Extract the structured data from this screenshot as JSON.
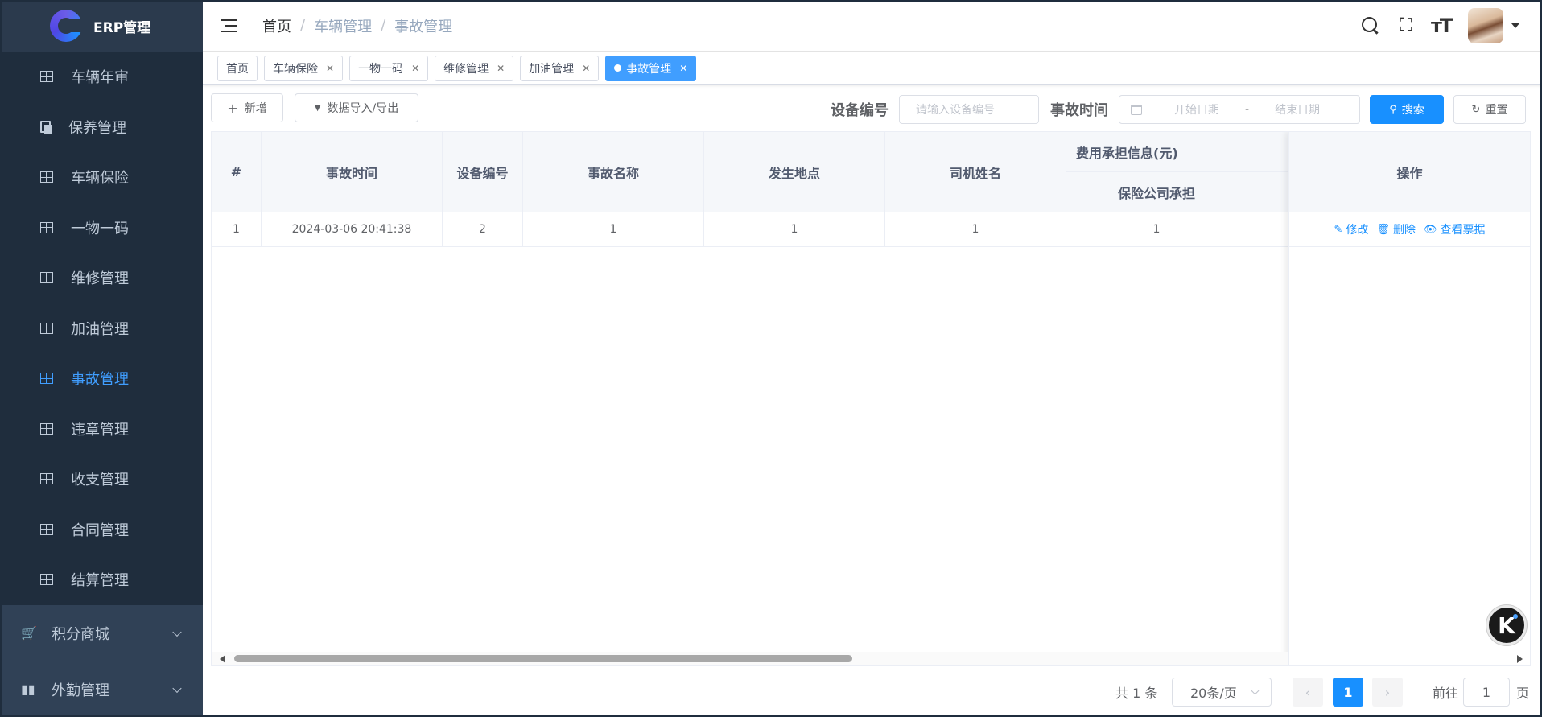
{
  "app": {
    "logo_text": "ERP管理"
  },
  "sidebar": {
    "items": [
      {
        "label": "车辆年审",
        "icon": "table-icon",
        "active": false
      },
      {
        "label": "保养管理",
        "icon": "copy-icon",
        "active": false
      },
      {
        "label": "车辆保险",
        "icon": "table-icon",
        "active": false
      },
      {
        "label": "一物一码",
        "icon": "table-icon",
        "active": false
      },
      {
        "label": "维修管理",
        "icon": "table-icon",
        "active": false
      },
      {
        "label": "加油管理",
        "icon": "table-icon",
        "active": false
      },
      {
        "label": "事故管理",
        "icon": "table-icon",
        "active": true
      },
      {
        "label": "违章管理",
        "icon": "table-icon",
        "active": false
      },
      {
        "label": "收支管理",
        "icon": "table-icon",
        "active": false
      },
      {
        "label": "合同管理",
        "icon": "table-icon",
        "active": false
      },
      {
        "label": "结算管理",
        "icon": "table-icon",
        "active": false
      }
    ],
    "groups": [
      {
        "label": "积分商城",
        "icon": "cart-icon"
      },
      {
        "label": "外勤管理",
        "icon": "bar-chart-icon"
      }
    ]
  },
  "header": {
    "breadcrumb": [
      "首页",
      "车辆管理",
      "事故管理"
    ],
    "separator": "/"
  },
  "tags": [
    {
      "label": "首页",
      "closable": false,
      "active": false
    },
    {
      "label": "车辆保险",
      "closable": true,
      "active": false
    },
    {
      "label": "一物一码",
      "closable": true,
      "active": false
    },
    {
      "label": "维修管理",
      "closable": true,
      "active": false
    },
    {
      "label": "加油管理",
      "closable": true,
      "active": false
    },
    {
      "label": "事故管理",
      "closable": true,
      "active": true
    }
  ],
  "toolbar": {
    "add_label": "新增",
    "import_export_label": "数据导入/导出",
    "device_no_label": "设备编号",
    "device_no_placeholder": "请输入设备编号",
    "accident_time_label": "事故时间",
    "start_date_placeholder": "开始日期",
    "date_separator": "-",
    "end_date_placeholder": "结束日期",
    "search_label": "搜索",
    "reset_label": "重置"
  },
  "table": {
    "headers": {
      "index": "#",
      "accident_time": "事故时间",
      "device_no": "设备编号",
      "accident_name": "事故名称",
      "location": "发生地点",
      "driver_name": "司机姓名",
      "cost_group": "费用承担信息(元)",
      "insurer_cost": "保险公司承担",
      "operations": "操作"
    },
    "rows": [
      {
        "index": "1",
        "accident_time": "2024-03-06 20:41:38",
        "device_no": "2",
        "accident_name": "1",
        "location": "1",
        "driver_name": "1",
        "insurer_cost": "1"
      }
    ],
    "operations": {
      "edit": "修改",
      "delete": "删除",
      "view_receipt": "查看票据"
    }
  },
  "pagination": {
    "total_text": "共 1 条",
    "page_size": "20条/页",
    "current_page": "1",
    "goto_label": "前往",
    "goto_value": "1",
    "page_suffix": "页"
  },
  "widget": {
    "letter": "K"
  },
  "colors": {
    "sidebar_bg": "#304156",
    "active_blue": "#409eff",
    "primary": "#1890ff"
  }
}
